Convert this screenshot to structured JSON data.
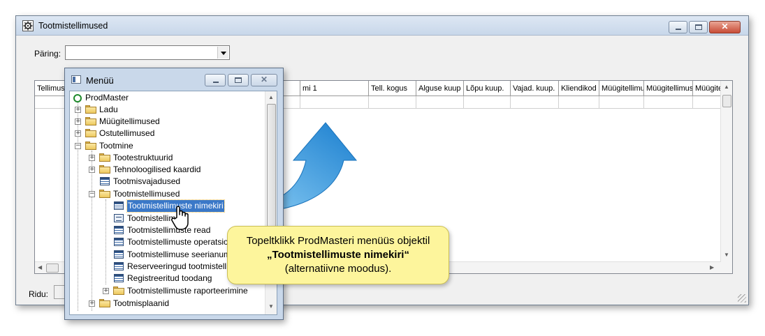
{
  "window": {
    "title": "Tootmistellimused",
    "query_label": "Päring:",
    "query_value": "",
    "columns": [
      "Tellimus",
      "mi 1",
      "Tell. kogus",
      "Alguse kuup",
      "Lõpu kuup.",
      "Vajad. kuup.",
      "Kliendikod",
      "Müügitellimu",
      "Müügitellimus",
      "Müügitellir"
    ],
    "status_label": "Ridu:",
    "status_value": ""
  },
  "menu": {
    "title": "Menüü",
    "tree": [
      {
        "label": "ProdMaster",
        "icon": "root-icon"
      },
      {
        "label": "Ladu",
        "icon": "folder-icon",
        "expander": "+"
      },
      {
        "label": "Müügitellimused",
        "icon": "folder-icon",
        "expander": "+"
      },
      {
        "label": "Ostutellimused",
        "icon": "folder-icon",
        "expander": "+"
      },
      {
        "label": "Tootmine",
        "icon": "folder-open-icon",
        "expander": "−"
      },
      {
        "label": "Tootestruktuurid",
        "icon": "folder-icon",
        "expander": "+"
      },
      {
        "label": "Tehnoloogilised kaardid",
        "icon": "folder-icon",
        "expander": "+"
      },
      {
        "label": "Tootmisvajadused",
        "icon": "table-icon"
      },
      {
        "label": "Tootmistellimused",
        "icon": "folder-open-icon",
        "expander": "−"
      },
      {
        "label": "Tootmistellimuste nimekiri",
        "icon": "table-icon",
        "selected": true
      },
      {
        "label": "Tootmistellim",
        "icon": "form-icon"
      },
      {
        "label": "Tootmistellimuste read",
        "icon": "table-icon"
      },
      {
        "label": "Tootmistellimuste operatsio",
        "icon": "table-icon"
      },
      {
        "label": "Tootmistellimuse seerianum",
        "icon": "table-icon"
      },
      {
        "label": "Reserveeringud tootmistelli",
        "icon": "table-icon"
      },
      {
        "label": "Registreeritud toodang",
        "icon": "table-icon"
      },
      {
        "label": "Tootmistellimuste raporteerimine",
        "icon": "folder-icon",
        "expander": "+"
      },
      {
        "label": "Tootmisplaanid",
        "icon": "folder-icon",
        "expander": "+"
      }
    ]
  },
  "callout": {
    "line1": "Topeltklikk ProdMasteri menüüs objektil",
    "line2": "„Tootmistellimuste nimekiri“",
    "line3": "(alternatiivne moodus)."
  },
  "colors": {
    "arrow": "#2b8fd6",
    "selection": "#3a78c8",
    "callout_bg": "#fdf59c"
  }
}
